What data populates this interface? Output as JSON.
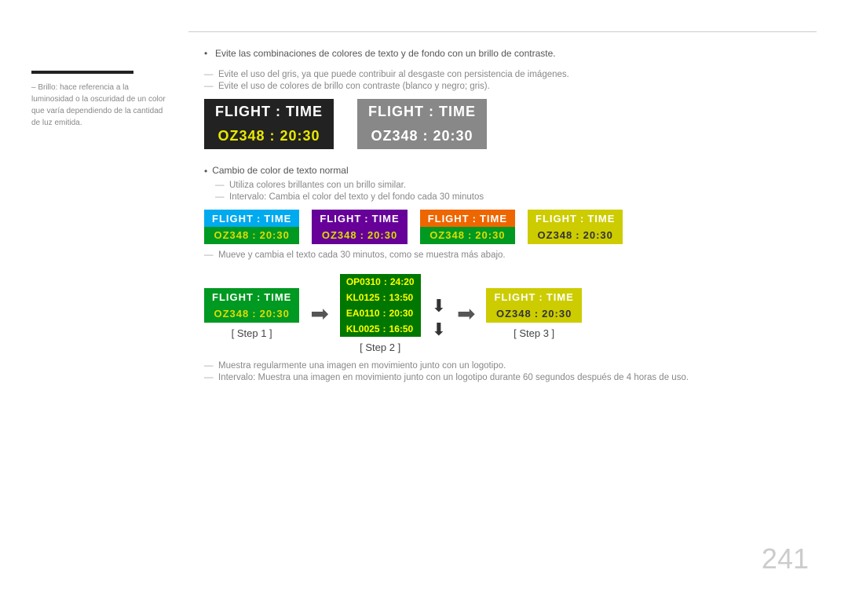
{
  "sidebar": {
    "rule": true,
    "text": "– Brillo: hace referencia a la luminosidad o la oscuridad de un color que varía dependiendo de la cantidad de luz emitida."
  },
  "main": {
    "bullet1": "Evite las combinaciones de colores de texto y de fondo con un brillo de contraste.",
    "dash1": "Evite el uso del gris, ya que puede contribuir al desgaste con persistencia de imágenes.",
    "dash2": "Evite el uso de colores de brillo con contraste (blanco y negro; gris).",
    "section2_bullet": "Cambio de color de texto normal",
    "section2_dash1": "Utiliza colores brillantes con un brillo similar.",
    "section2_dash2": "Intervalo: Cambia el color del texto y del fondo cada 30 minutos",
    "section3_dash": "Mueve y cambia el texto cada 30 minutos, como se muestra más abajo.",
    "section4_dash1": "Muestra regularmente una imagen en movimiento junto con un logotipo.",
    "section4_dash2": "Intervalo: Muestra una imagen en movimiento junto con un logotipo durante 60 segundos después de 4 horas de uso.",
    "step1_label": "[ Step 1 ]",
    "step2_label": "[ Step 2 ]",
    "step3_label": "[ Step 3 ]",
    "flight_label": "FLIGHT",
    "time_label": "TIME",
    "colon": ":",
    "oz348": "OZ348",
    "time_val": "20:30",
    "large_display1": {
      "theme": "black",
      "top": "FLIGHT  :  TIME",
      "bottom": "OZ348   :  20:30"
    },
    "large_display2": {
      "theme": "gray",
      "top": "FLIGHT  :  TIME",
      "bottom": "OZ348   :  20:30"
    },
    "color_displays": [
      {
        "theme": "blue",
        "top": "FLIGHT  :  TIME",
        "bottom": "OZ348  :  20:30"
      },
      {
        "theme": "purple",
        "top": "FLIGHT  :  TIME",
        "bottom": "OZ348  :  20:30"
      },
      {
        "theme": "orange",
        "top": "FLIGHT  :  TIME",
        "bottom": "OZ348  :  20:30"
      },
      {
        "theme": "yellow",
        "top": "FLIGHT  :  TIME",
        "bottom": "OZ348  :  20:30"
      }
    ],
    "step1_display": {
      "theme": "step1",
      "top": "FLIGHT  :  TIME",
      "bottom": "OZ348  :  20:30"
    },
    "step2_rows": [
      "OP0310  :  24:20",
      "KL0125  :  13:50",
      "EA0110  :  20:30",
      "KL0025  :  16:50"
    ],
    "step3_display": {
      "theme": "step3",
      "top": "FLIGHT  :  TIME",
      "bottom": "OZ348  :  20:30"
    }
  },
  "page_number": "241"
}
